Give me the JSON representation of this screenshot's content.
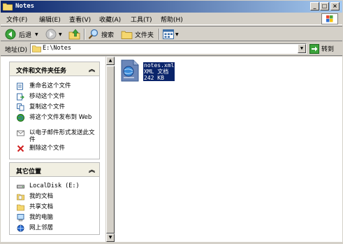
{
  "window": {
    "title": "Notes"
  },
  "menu": [
    "文件(F)",
    "编辑(E)",
    "查看(V)",
    "收藏(A)",
    "工具(T)",
    "帮助(H)"
  ],
  "toolbar": {
    "back": "后退",
    "search": "搜索",
    "folders": "文件夹"
  },
  "address": {
    "label": "地址(D)",
    "value": "E:\\Notes",
    "go": "转到"
  },
  "tasks_panel": {
    "title": "文件和文件夹任务",
    "items": [
      "重命名这个文件",
      "移动这个文件",
      "复制这个文件",
      "将这个文件发布到 Web",
      "以电子邮件形式发送此文件",
      "删除这个文件"
    ]
  },
  "places_panel": {
    "title": "其它位置",
    "items": [
      "LocalDisk (E:)",
      "我的文档",
      "共享文档",
      "我的电脑",
      "网上邻居"
    ]
  },
  "file": {
    "name": "notes.xml",
    "type": "XML 文档",
    "size": "242 KB"
  },
  "colors": {
    "title_start": "#0a246a",
    "title_end": "#a6caf0",
    "selection": "#0a246a"
  }
}
